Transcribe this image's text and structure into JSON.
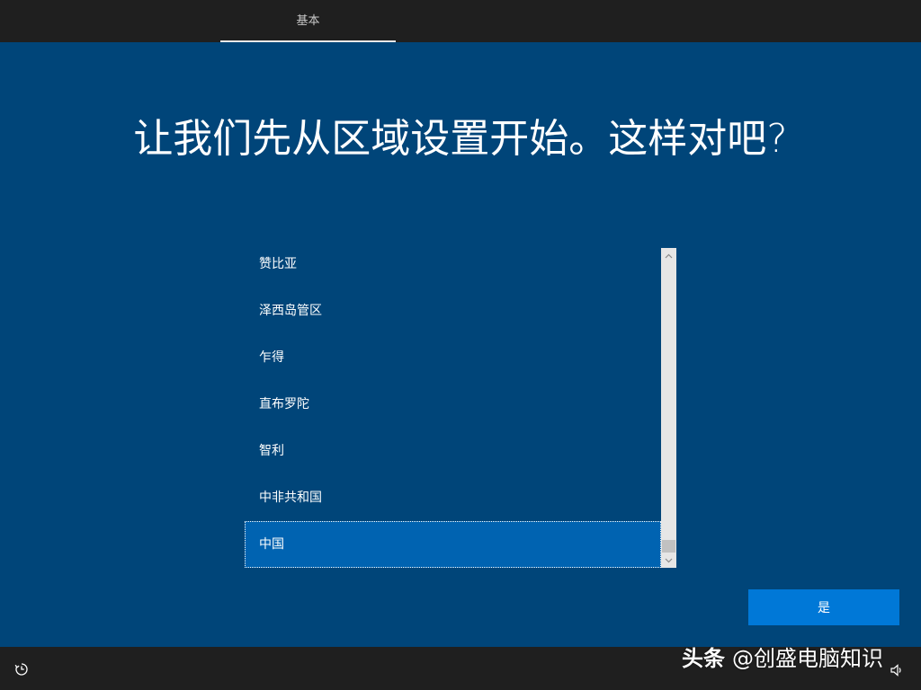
{
  "header": {
    "tabs": [
      {
        "label": "基本",
        "active": true
      }
    ]
  },
  "main": {
    "title": "让我们先从区域设置开始。这样对吧?",
    "region_list": {
      "items": [
        {
          "label": "赞比亚",
          "selected": false
        },
        {
          "label": "泽西岛管区",
          "selected": false
        },
        {
          "label": "乍得",
          "selected": false
        },
        {
          "label": "直布罗陀",
          "selected": false
        },
        {
          "label": "智利",
          "selected": false
        },
        {
          "label": "中非共和国",
          "selected": false
        },
        {
          "label": "中国",
          "selected": true
        }
      ],
      "scrollbar_icons": {
        "up": "chevron-up-icon",
        "down": "chevron-down-icon"
      }
    },
    "confirm_button": {
      "label": "是"
    }
  },
  "footer": {
    "left_icon": "ease-of-access-icon",
    "right_icon": "volume-icon"
  },
  "watermark": {
    "brand": "头条",
    "handle": "@创盛电脑知识"
  },
  "colors": {
    "background": "#004579",
    "bars": "#1f1f1f",
    "selected_item": "#0063b1",
    "primary_button": "#0078d7",
    "scrollbar_track": "#e6e6e6"
  }
}
